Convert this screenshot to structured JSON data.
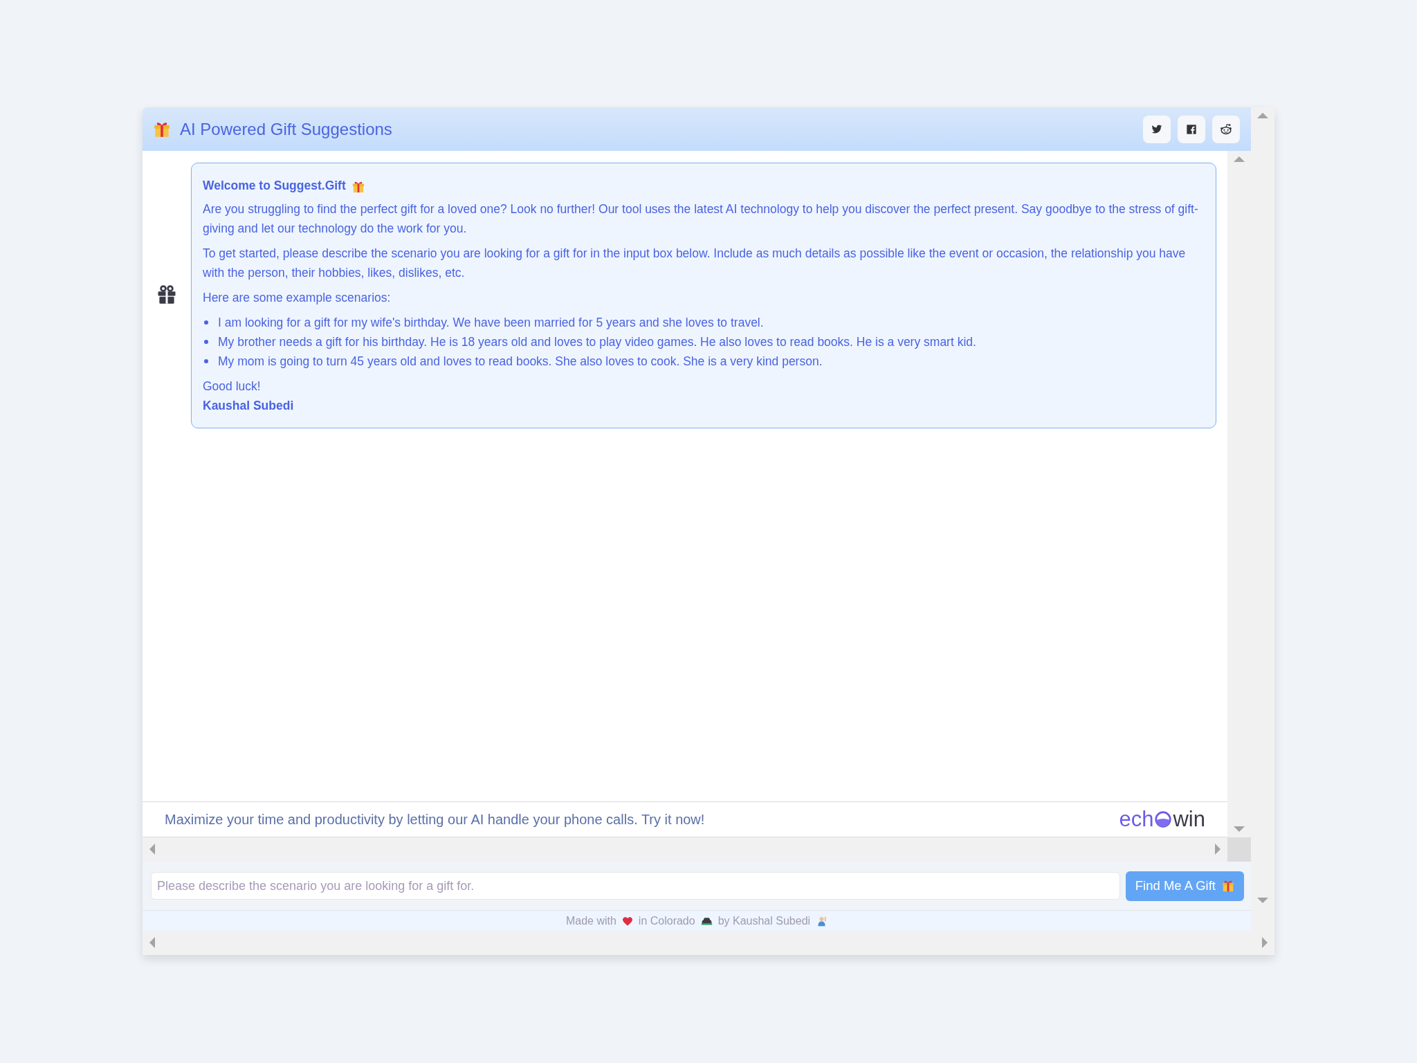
{
  "header": {
    "title": "AI Powered Gift Suggestions",
    "share_buttons": [
      {
        "kind": "twitter"
      },
      {
        "kind": "facebook"
      },
      {
        "kind": "reddit"
      }
    ]
  },
  "message": {
    "title": "Welcome to Suggest.Gift",
    "paragraphs": [
      "Are you struggling to find the perfect gift for a loved one? Look no further! Our tool uses the latest AI technology to help you discover the perfect present. Say goodbye to the stress of gift-giving and let our technology do the work for you.",
      "To get started, please describe the scenario you are looking for a gift for in the input box below. Include as much details as possible like the event or occasion, the relationship you have with the person, their hobbies, likes, dislikes, etc.",
      "Here are some example scenarios:"
    ],
    "examples": [
      "I am looking for a gift for my wife's birthday. We have been married for 5 years and she loves to travel.",
      "My brother needs a gift for his birthday. He is 18 years old and loves to play video games. He also loves to read books. He is a very smart kid.",
      "My mom is going to turn 45 years old and loves to read books. She also loves to cook. She is a very kind person."
    ],
    "closing": "Good luck!",
    "signature": "Kaushal Subedi"
  },
  "ad": {
    "text": "Maximize your time and productivity by letting our AI handle your phone calls. Try it now!",
    "logo_prefix": "ech",
    "logo_suffix": "win"
  },
  "input": {
    "placeholder": "Please describe the scenario you are looking for a gift for."
  },
  "submit_button": {
    "label": "Find Me A Gift"
  },
  "footer": [
    {
      "kind": "text",
      "text": "Made with"
    },
    {
      "kind": "heart"
    },
    {
      "kind": "text",
      "text": "in Colorado"
    },
    {
      "kind": "car"
    },
    {
      "kind": "text",
      "text": "by Kaushal Subedi"
    },
    {
      "kind": "person"
    }
  ]
}
